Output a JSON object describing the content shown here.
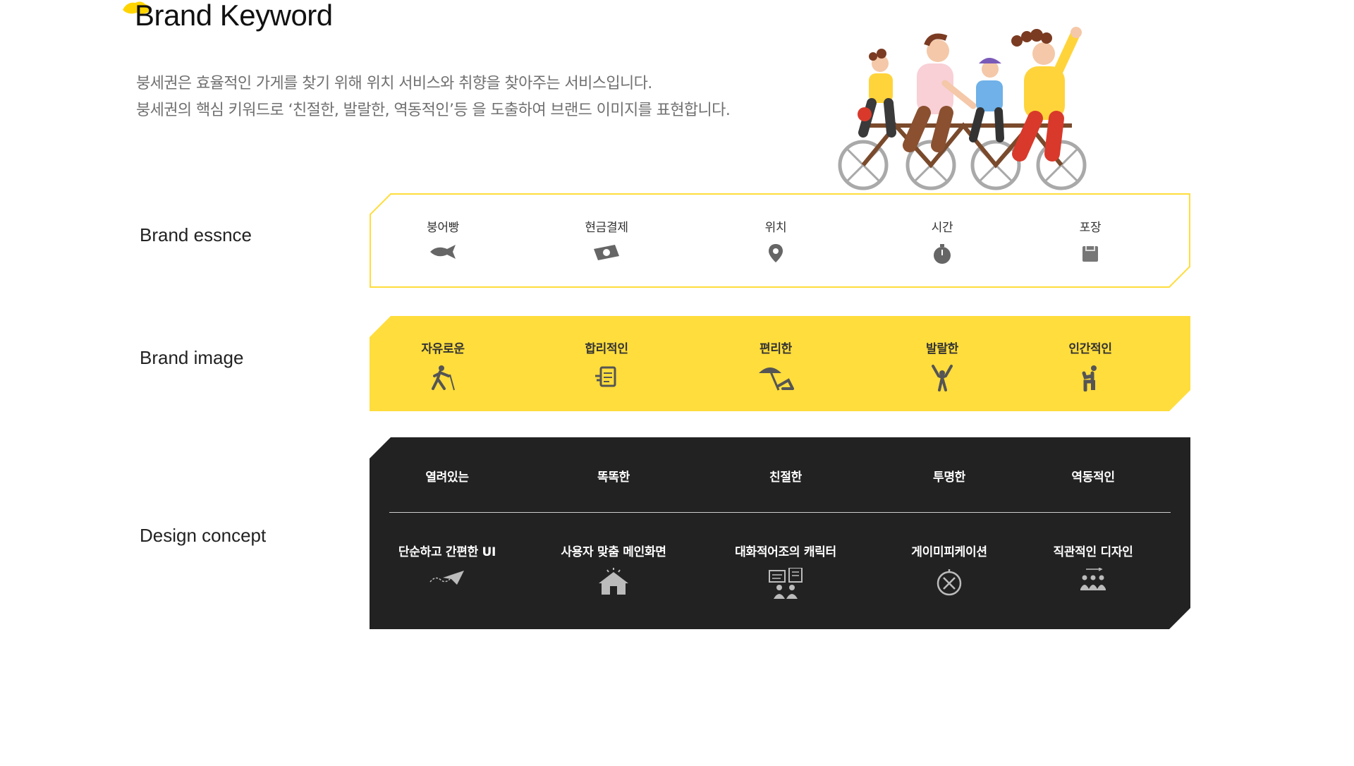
{
  "header": {
    "title": "Brand Keyword",
    "description_lines": [
      "붕세권은 효율적인 가게를 찾기 위해 위치 서비스와 취향을 찾아주는 서비스입니다.",
      "붕세권의 핵심 키워드로 ‘친절한, 발랄한, 역동적인’등 을 도출하여 브랜드 이미지를 표현합니다."
    ]
  },
  "colors": {
    "accent_yellow": "#FFDD3C",
    "dark_panel": "#222222",
    "icon_gray": "#6b6b6b"
  },
  "brand_essence": {
    "label": "Brand essnce",
    "items": [
      {
        "label": "붕어빵",
        "icon": "fish-icon"
      },
      {
        "label": "현금결제",
        "icon": "cash-icon"
      },
      {
        "label": "위치",
        "icon": "location-pin-icon"
      },
      {
        "label": "시간",
        "icon": "stopwatch-icon"
      },
      {
        "label": "포장",
        "icon": "package-icon"
      }
    ]
  },
  "brand_image": {
    "label": "Brand image",
    "items": [
      {
        "label": "자유로운",
        "icon": "hiker-icon"
      },
      {
        "label": "합리적인",
        "icon": "document-icon"
      },
      {
        "label": "편리한",
        "icon": "beach-chair-icon"
      },
      {
        "label": "발랄한",
        "icon": "cheering-person-icon"
      },
      {
        "label": "인간적인",
        "icon": "seated-person-icon"
      }
    ]
  },
  "design_concept": {
    "label": "Design concept",
    "keywords": [
      "열려있는",
      "똑똑한",
      "친절한",
      "투명한",
      "역동적인"
    ],
    "items": [
      {
        "label": "단순하고 간편한 UI",
        "icon": "paper-plane-icon"
      },
      {
        "label": "사용자 맞춤 메인화면",
        "icon": "home-icon"
      },
      {
        "label": "대화적어조의 캐릭터",
        "icon": "chat-people-icon"
      },
      {
        "label": "게이미피케이션",
        "icon": "compass-icon"
      },
      {
        "label": "직관적인 디자인",
        "icon": "group-icon"
      }
    ]
  }
}
